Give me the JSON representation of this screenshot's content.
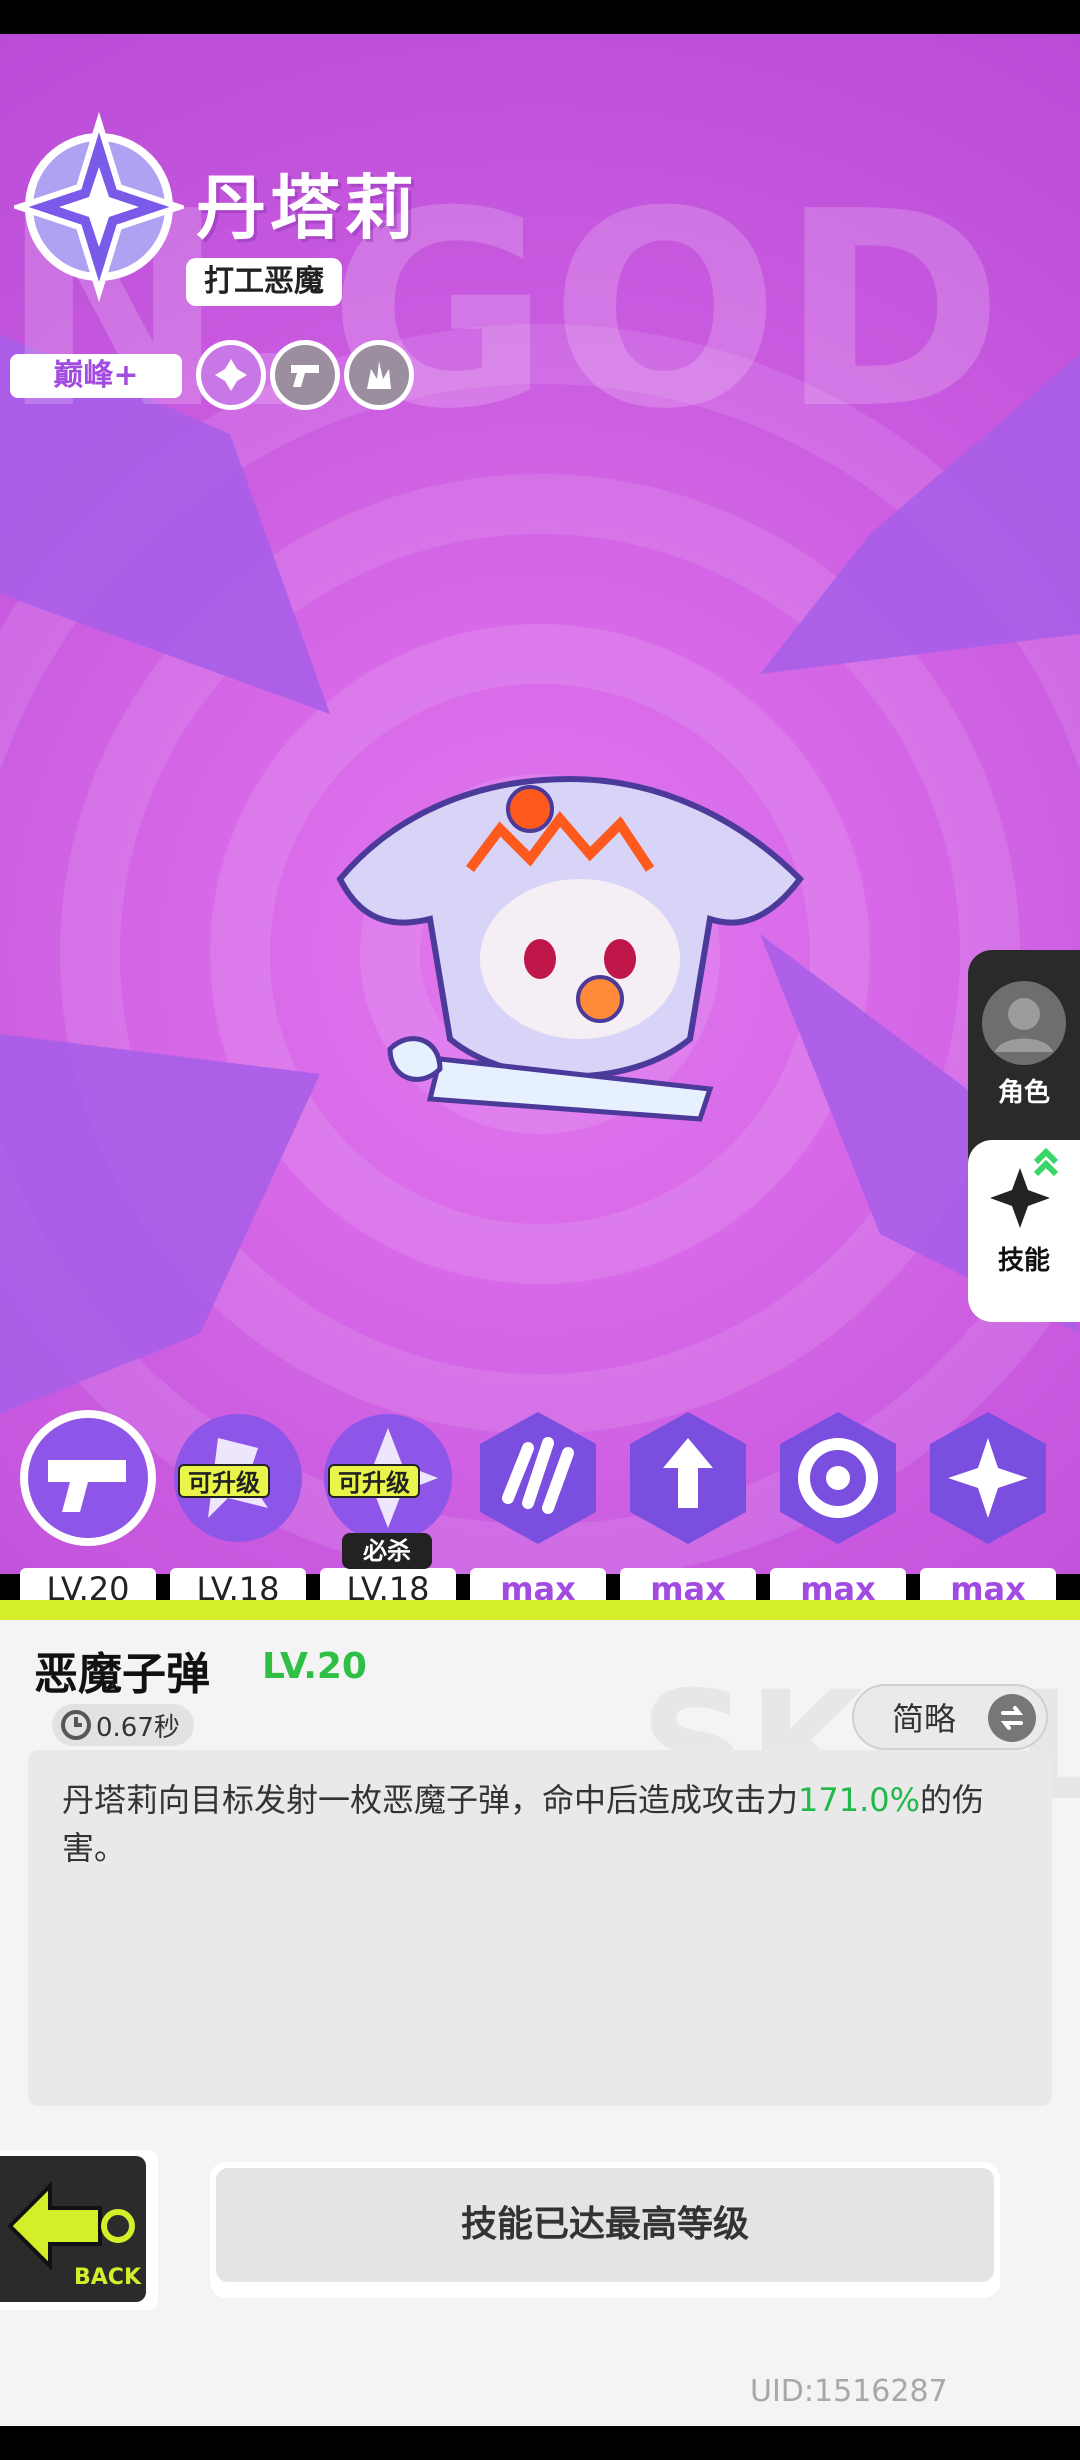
{
  "character": {
    "name": "丹塔莉",
    "title": "打工恶魔",
    "rank": "巅峰+",
    "background_text": "N.GOD",
    "trait_icons": [
      "clover-icon",
      "pistol-icon",
      "fire-icon"
    ]
  },
  "side_tabs": [
    {
      "label": "角色",
      "icon": "avatar-icon"
    },
    {
      "label": "技能",
      "icon": "sparkle-icon"
    }
  ],
  "skills": [
    {
      "level": "LV.20",
      "icon": "pistol-skill-icon"
    },
    {
      "level": "LV.18",
      "icon": "burst-skill-icon",
      "tag": "可升级"
    },
    {
      "level": "LV.18",
      "icon": "ultimate-skill-icon",
      "tag": "可升级",
      "ult": "必杀"
    },
    {
      "level": "max",
      "icon": "claw-skill-icon"
    },
    {
      "level": "max",
      "icon": "arrow-up-skill-icon"
    },
    {
      "level": "max",
      "icon": "vortex-skill-icon"
    },
    {
      "level": "max",
      "icon": "shuriken-skill-icon"
    }
  ],
  "selected_skill": {
    "name": "恶魔子弹",
    "level": "LV.20",
    "cooldown": "0.67秒",
    "brief_label": "简略",
    "desc_before": "丹塔莉向目标发射一枚恶魔子弹，命中后造成攻击力",
    "desc_value": "171.0%",
    "desc_after": "的伤害。"
  },
  "buttons": {
    "back": "BACK",
    "max_level": "技能已达最高等级"
  },
  "uid": "UID:1516287",
  "colors": {
    "accent_purple": "#a24be0",
    "lime": "#d4ef2a",
    "highlight_green": "#22b84a"
  }
}
